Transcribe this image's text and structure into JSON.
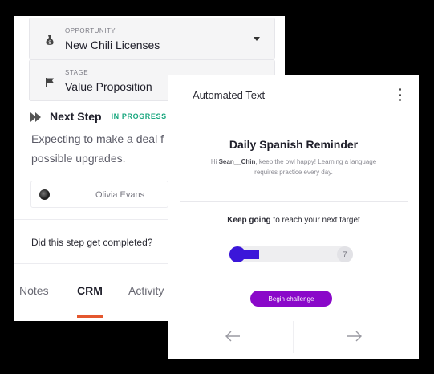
{
  "crm": {
    "opportunity": {
      "label": "OPPORTUNITY",
      "value": "New Chili Licenses"
    },
    "stage": {
      "label": "STAGE",
      "value": "Value Proposition"
    },
    "next_step": {
      "title": "Next Step",
      "status": "IN PROGRESS",
      "description_line1": "Expecting to make a deal f",
      "description_line2": "possible upgrades."
    },
    "owner": {
      "name": "Olivia Evans"
    },
    "question": "Did this step get completed?",
    "tabs": [
      {
        "label": "Notes"
      },
      {
        "label": "CRM"
      },
      {
        "label": "Activity"
      }
    ],
    "active_tab": "CRM",
    "accent_color": "#e4572e",
    "status_color": "#1aa77f"
  },
  "automated_text": {
    "header_title": "Automated Text",
    "message_title": "Daily Spanish Reminder",
    "greeting_prefix": "Hi ",
    "greeting_name": "Sean__Chin",
    "greeting_rest": ", keep the owl happy! Learning a language requires practice every day.",
    "goal_strong": "Keep going",
    "goal_rest": " to reach your next target",
    "progress_fraction": 0.24,
    "target_value": "7",
    "cta_label": "Begin challenge",
    "cta_color": "#8a08c9",
    "progress_color": "#3b16d9",
    "icons": {
      "prev": "arrow-left-icon",
      "next": "arrow-right-icon",
      "menu": "kebab-menu-icon"
    }
  }
}
